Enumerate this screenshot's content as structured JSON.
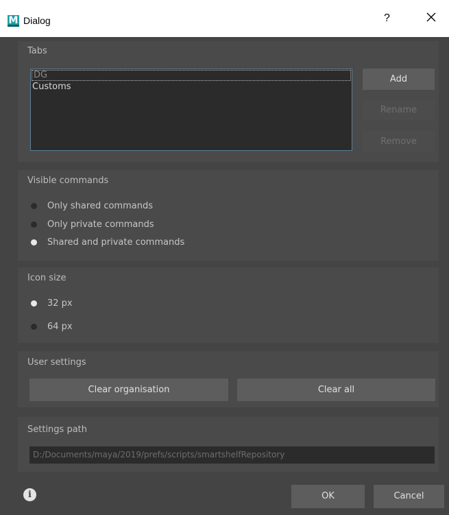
{
  "window": {
    "title": "Dialog",
    "app_icon_letter": "M",
    "help_label": "?"
  },
  "tabs_group": {
    "title": "Tabs",
    "items": [
      "DG",
      "Customs"
    ],
    "buttons": {
      "add": "Add",
      "rename": "Rename",
      "remove": "Remove"
    }
  },
  "visible_commands": {
    "title": "Visible commands",
    "options": [
      "Only shared commands",
      "Only private commands",
      "Shared and private commands"
    ],
    "selected": "Shared and private commands"
  },
  "icon_size": {
    "title": "Icon size",
    "options": [
      "32 px",
      "64 px"
    ],
    "selected": "32 px"
  },
  "user_settings": {
    "title": "User settings",
    "clear_organisation": "Clear organisation",
    "clear_all": "Clear all"
  },
  "settings_path": {
    "title": "Settings path",
    "value": "D:/Documents/maya/2019/prefs/scripts/smartshelfRepository"
  },
  "footer": {
    "info_glyph": "i",
    "ok": "OK",
    "cancel": "Cancel"
  },
  "colors": {
    "background": "#444444",
    "group": "#4a4a4a",
    "field": "#2b2b2b",
    "focus_border": "#5d7f97",
    "button": "#5d5d5d"
  }
}
